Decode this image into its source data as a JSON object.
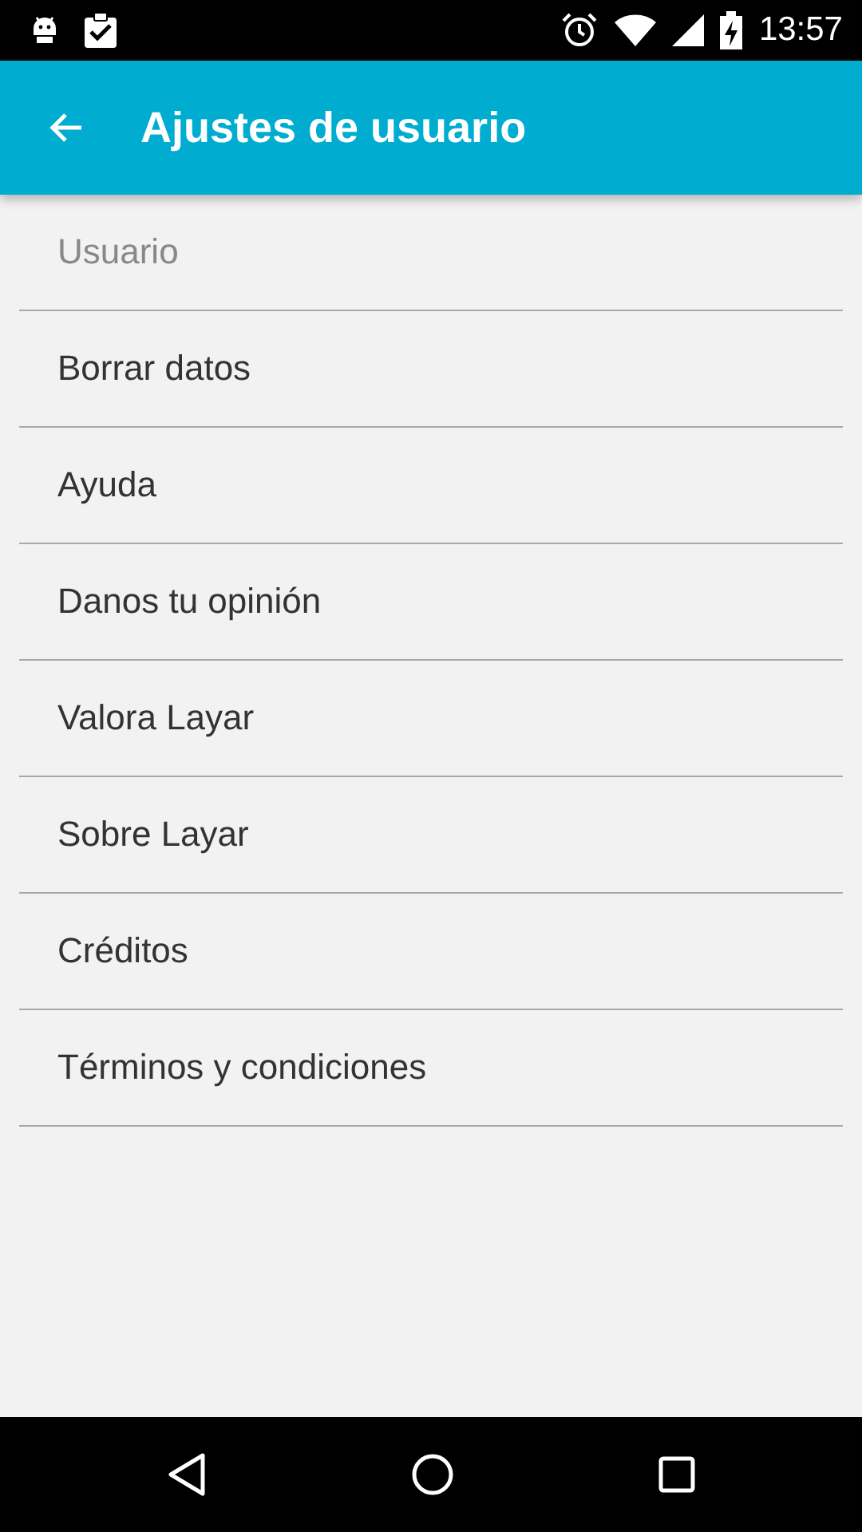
{
  "status_bar": {
    "time": "13:57"
  },
  "app_bar": {
    "title": "Ajustes de usuario"
  },
  "list": [
    {
      "text": "Usuario",
      "kind": "header"
    },
    {
      "text": "Borrar datos",
      "kind": "item"
    },
    {
      "text": "Ayuda",
      "kind": "item"
    },
    {
      "text": "Danos tu opinión",
      "kind": "item"
    },
    {
      "text": "Valora Layar",
      "kind": "item"
    },
    {
      "text": "Sobre Layar",
      "kind": "item"
    },
    {
      "text": "Créditos",
      "kind": "item"
    },
    {
      "text": "Términos y condiciones",
      "kind": "item"
    }
  ]
}
